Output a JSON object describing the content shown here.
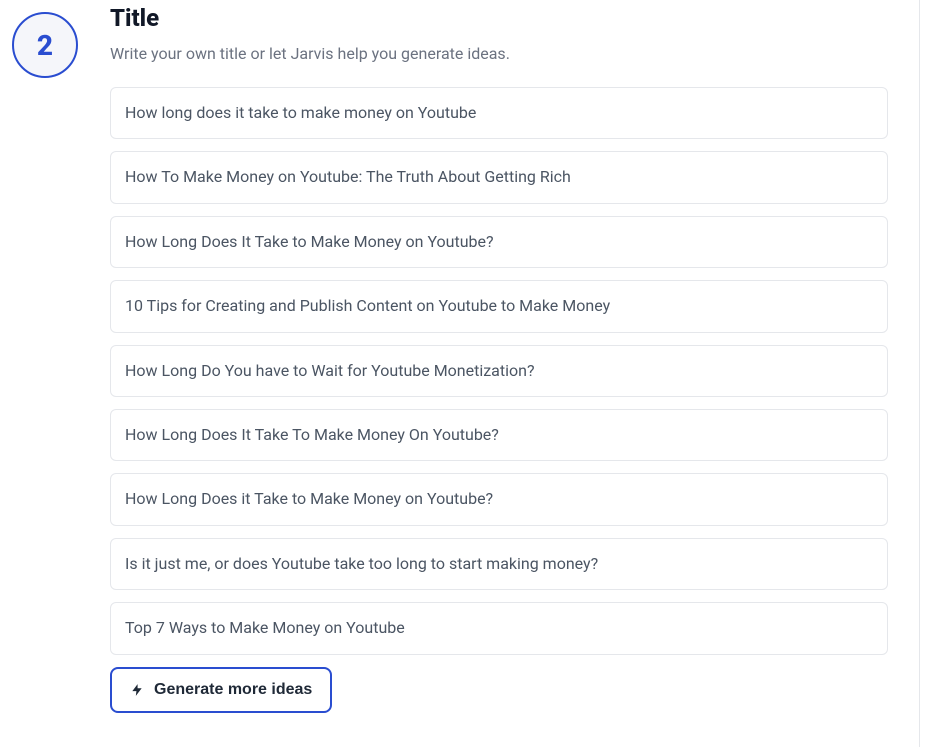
{
  "step": {
    "number": "2",
    "heading": "Title",
    "subtitle": "Write your own title or let Jarvis help you generate ideas."
  },
  "suggestions": [
    "How long does it take to make money on Youtube",
    "How To Make Money on Youtube: The Truth About Getting Rich",
    "How Long Does It Take to Make Money on Youtube?",
    "10 Tips for Creating and Publish Content on Youtube to Make Money",
    "How Long Do You have to Wait for Youtube Monetization?",
    "How Long Does It Take To Make Money On Youtube?",
    "How Long Does it Take to Make Money on Youtube?",
    "Is it just me, or does Youtube take too long to start making money?",
    "Top 7 Ways to Make Money on Youtube"
  ],
  "generate_button": "Generate more ideas"
}
